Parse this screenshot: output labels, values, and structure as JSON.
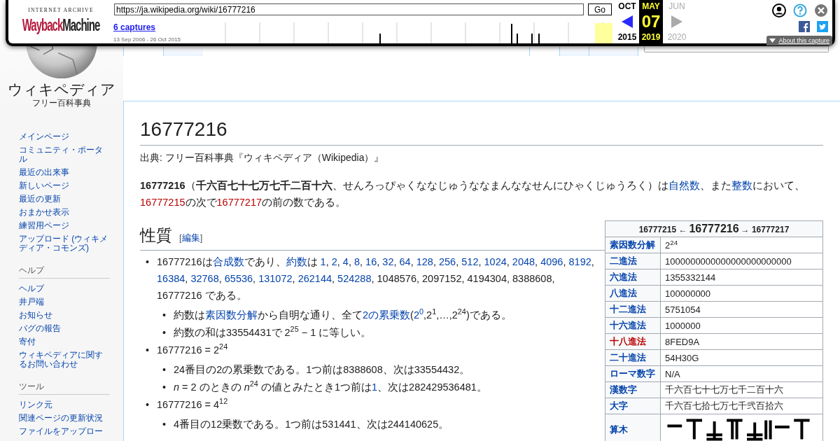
{
  "wayback": {
    "logo_top": "INTERNET ARCHIVE",
    "logo_brand": "Wayback",
    "logo_brand2": "Machine",
    "url": "https://ja.wikipedia.org/wiki/16777216",
    "go": "Go",
    "captures": "6 captures",
    "range": "13 Sep 2006 - 26 Oct 2015",
    "calendar": [
      {
        "month": "OCT",
        "year": "2015",
        "kind": "prev",
        "selected": false
      },
      {
        "month": "MAY",
        "day": "07",
        "year": "2019",
        "kind": "current",
        "selected": true
      },
      {
        "month": "JUN",
        "year": "2020",
        "kind": "next",
        "selected": false
      }
    ],
    "about": "About this capture"
  },
  "sidebar": {
    "wordmark": "ウィキペディア",
    "tagline": "フリー百科事典",
    "sections": [
      {
        "items": [
          "メインページ",
          "コミュニティ・ポータル",
          "最近の出来事",
          "新しいページ",
          "最近の更新",
          "おまかせ表示",
          "練習用ページ",
          "アップロード (ウィキメディア・コモンズ)"
        ]
      },
      {
        "heading": "ヘルプ",
        "items": [
          "ヘルプ",
          "井戸端",
          "お知らせ",
          "バグの報告",
          "寄付",
          "ウィキペディアに関するお問い合わせ"
        ]
      },
      {
        "heading": "ツール",
        "items": [
          "リンク元",
          "関連ページの更新状況",
          "ファイルをアップロー"
        ]
      }
    ]
  },
  "article": {
    "title": "16777216",
    "subtitle": "出典: フリー百科事典『ウィキペディア（Wikipedia）』",
    "intro": [
      {
        "kind": "plain",
        "t": "**16777216**（**千六百七十七万七千二百十六**、せんろっぴゃくななじゅうななまんななせんにひゃくじゅうろく）は"
      },
      {
        "kind": "link",
        "t": "自然数"
      },
      {
        "kind": "plain",
        "t": "、また"
      },
      {
        "kind": "link",
        "t": "整数"
      },
      {
        "kind": "plain",
        "t": "において、"
      },
      {
        "kind": "redlink",
        "t": "16777215"
      },
      {
        "kind": "plain",
        "t": "の次で"
      },
      {
        "kind": "redlink",
        "t": "16777217"
      },
      {
        "kind": "plain",
        "t": "の前の数である。"
      }
    ],
    "section": {
      "heading": "性質",
      "edit_open": "[",
      "edit": "編集",
      "edit_close": "]"
    },
    "bullets": [
      {
        "marker": "•",
        "segments": [
          {
            "kind": "plain",
            "t": "16777216は"
          },
          {
            "kind": "link",
            "t": "合成数"
          },
          {
            "kind": "plain",
            "t": "であり、"
          },
          {
            "kind": "link",
            "t": "約数"
          },
          {
            "kind": "plain",
            "t": "は "
          },
          {
            "kind": "link",
            "t": "1"
          },
          {
            "kind": "plain",
            "t": ", "
          },
          {
            "kind": "link",
            "t": "2"
          },
          {
            "kind": "plain",
            "t": ", "
          },
          {
            "kind": "link",
            "t": "4"
          },
          {
            "kind": "plain",
            "t": ", "
          },
          {
            "kind": "link",
            "t": "8"
          },
          {
            "kind": "plain",
            "t": ", "
          },
          {
            "kind": "link",
            "t": "16"
          },
          {
            "kind": "plain",
            "t": ", "
          },
          {
            "kind": "link",
            "t": "32"
          },
          {
            "kind": "plain",
            "t": ", "
          },
          {
            "kind": "link",
            "t": "64"
          },
          {
            "kind": "plain",
            "t": ", "
          },
          {
            "kind": "link",
            "t": "128"
          },
          {
            "kind": "plain",
            "t": ", "
          },
          {
            "kind": "link",
            "t": "256"
          },
          {
            "kind": "plain",
            "t": ", "
          },
          {
            "kind": "link",
            "t": "512"
          },
          {
            "kind": "plain",
            "t": ", "
          },
          {
            "kind": "link",
            "t": "1024"
          },
          {
            "kind": "plain",
            "t": ", "
          },
          {
            "kind": "link",
            "t": "2048"
          },
          {
            "kind": "plain",
            "t": ", "
          },
          {
            "kind": "link",
            "t": "4096"
          },
          {
            "kind": "plain",
            "t": ", "
          },
          {
            "kind": "link",
            "t": "8192"
          },
          {
            "kind": "plain",
            "t": ", "
          },
          {
            "kind": "link",
            "t": "16384"
          },
          {
            "kind": "plain",
            "t": ", "
          },
          {
            "kind": "link",
            "t": "32768"
          },
          {
            "kind": "plain",
            "t": ", "
          },
          {
            "kind": "link",
            "t": "65536"
          },
          {
            "kind": "plain",
            "t": ", "
          },
          {
            "kind": "link",
            "t": "131072"
          },
          {
            "kind": "plain",
            "t": ", "
          },
          {
            "kind": "link",
            "t": "262144"
          },
          {
            "kind": "plain",
            "t": ", "
          },
          {
            "kind": "link",
            "t": "524288"
          },
          {
            "kind": "plain",
            "t": ", 1048576, 2097152, 4194304, 8388608, 16777216 である。"
          }
        ],
        "children": [
          {
            "marker": "•",
            "segments": [
              {
                "kind": "plain",
                "t": "約数は"
              },
              {
                "kind": "link",
                "t": "素因数分解"
              },
              {
                "kind": "plain",
                "t": "から自明な通り、全て"
              },
              {
                "kind": "link",
                "t": "2の累乗数"
              },
              {
                "kind": "plain",
                "t": "("
              },
              {
                "kind": "link",
                "t": "2$^{0}$"
              },
              {
                "kind": "plain",
                "t": ",2$^{1}$,…,2$^{24}$)である。"
              }
            ]
          },
          {
            "marker": "•",
            "segments": [
              {
                "kind": "plain",
                "t": "約数の和は33554431で 2$^{25}$ − 1 に等しい。"
              }
            ]
          }
        ]
      },
      {
        "marker": "•",
        "segments": [
          {
            "kind": "plain",
            "t": "16777216 = 2$^{24}$"
          }
        ],
        "children": [
          {
            "marker": "•",
            "segments": [
              {
                "kind": "plain",
                "t": "24番目の2の累乗数である。1つ前は8388608、次は33554432。"
              }
            ]
          },
          {
            "marker": "•",
            "segments": [
              {
                "kind": "plain",
                "t": "*n* = 2 のときの *n*$^{24}$ の値とみたとき1つ前は"
              },
              {
                "kind": "link",
                "t": "1"
              },
              {
                "kind": "plain",
                "t": "、次は282429536481。"
              }
            ]
          }
        ]
      },
      {
        "marker": "•",
        "segments": [
          {
            "kind": "plain",
            "t": "16777216 = 4$^{12}$"
          }
        ],
        "children": [
          {
            "marker": "•",
            "segments": [
              {
                "kind": "plain",
                "t": "4番目の12乗数である。1つ前は531441、次は244140625。"
              }
            ]
          }
        ]
      }
    ]
  },
  "infobox": {
    "prev": "16777215 ←",
    "current": "16777216",
    "next": "→ 16777217",
    "rows": [
      {
        "label": "素因数分解",
        "kind": "link",
        "value": "2$^{24}$"
      },
      {
        "label": "二進法",
        "kind": "link",
        "value": "1000000000000000000000000"
      },
      {
        "label": "六進法",
        "kind": "link",
        "value": "1355332144"
      },
      {
        "label": "八進法",
        "kind": "link",
        "value": "100000000"
      },
      {
        "label": "十二進法",
        "kind": "link",
        "value": "5751054"
      },
      {
        "label": "十六進法",
        "kind": "link",
        "value": "1000000"
      },
      {
        "label": "十八進法",
        "kind": "redlink",
        "value": "8FED9A"
      },
      {
        "label": "二十進法",
        "kind": "link",
        "value": "54H30G"
      },
      {
        "label": "ローマ数字",
        "kind": "link",
        "value": "N/A"
      },
      {
        "label": "漢数字",
        "kind": "link",
        "value": "千六百七十七万七千二百十六"
      },
      {
        "label": "大字",
        "kind": "link",
        "value": "千六百七拾七万七千弐百拾六"
      },
      {
        "label": "算木",
        "kind": "link"
      }
    ]
  }
}
